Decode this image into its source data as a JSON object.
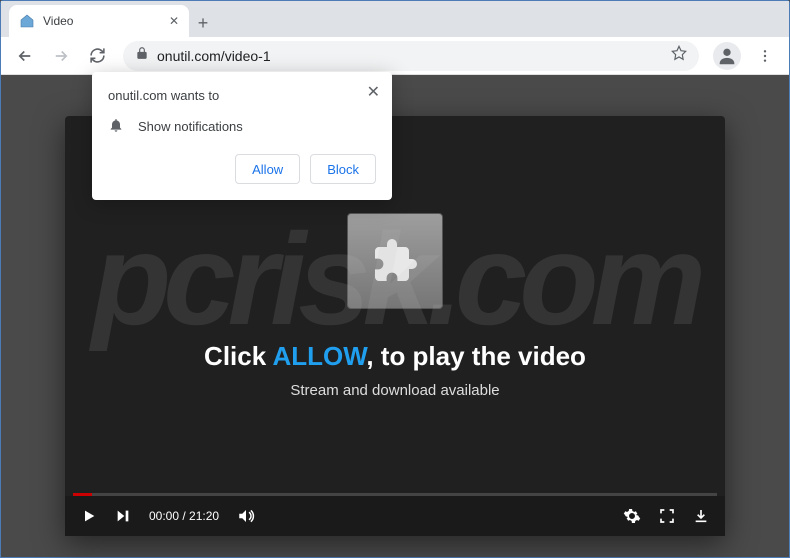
{
  "window": {
    "tab_title": "Video"
  },
  "toolbar": {
    "url": "onutil.com/video-1"
  },
  "notification": {
    "title": "onutil.com wants to",
    "body": "Show notifications",
    "allow_label": "Allow",
    "block_label": "Block"
  },
  "player": {
    "main_prefix": "Click ",
    "main_highlight": "ALLOW",
    "main_comma": ",",
    "main_suffix": " to play the video",
    "sub_text": "Stream and download available",
    "time_current": "00:00",
    "time_sep": " / ",
    "time_total": "21:20"
  },
  "watermark": "pcrisk.com"
}
